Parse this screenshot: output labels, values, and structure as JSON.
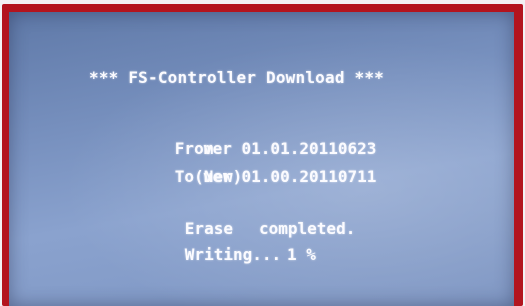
{
  "screen": {
    "title": "*** FS-Controller Download ***",
    "versions": {
      "from_label": "From",
      "from_value": "ver 01.01.20110623",
      "to_label": "To(New)",
      "to_value": "ver 01.00.20110711"
    },
    "status": {
      "erase_label": "Erase",
      "erase_value": "completed.",
      "writing_label": "Writing...",
      "writing_value": "1 %"
    }
  },
  "colors": {
    "bezel": "#b3141e",
    "screen_bg": "#7891bf",
    "text": "#fbfbff"
  }
}
